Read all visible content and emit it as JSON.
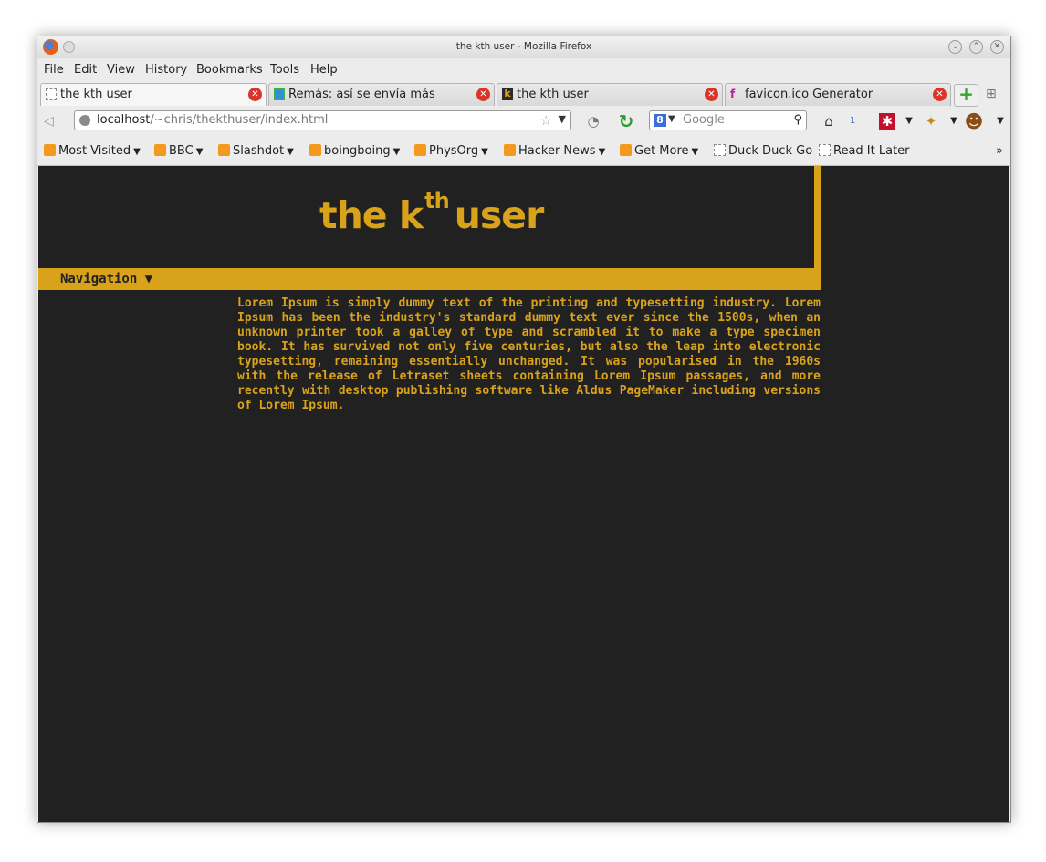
{
  "window": {
    "title": "the kth user - Mozilla Firefox"
  },
  "menu": {
    "items": [
      "File",
      "Edit",
      "View",
      "History",
      "Bookmarks",
      "Tools",
      "Help"
    ]
  },
  "tabs": [
    {
      "label": "the kth user",
      "active": true
    },
    {
      "label": "Remás: así se envía más",
      "active": false
    },
    {
      "label": "the kth user",
      "active": false
    },
    {
      "label": "favicon.ico Generator",
      "active": false
    }
  ],
  "navbar": {
    "url_host": "localhost",
    "url_path": "/~chris/thekthuser/index.html",
    "search_placeholder": "Google",
    "notification_count": "1"
  },
  "bookmarks": [
    {
      "label": "Most Visited",
      "icon": "folder-icon",
      "dropdown": true
    },
    {
      "label": "BBC",
      "icon": "rss-icon",
      "dropdown": true
    },
    {
      "label": "Slashdot",
      "icon": "rss-icon",
      "dropdown": true
    },
    {
      "label": "boingboing",
      "icon": "rss-icon",
      "dropdown": true
    },
    {
      "label": "PhysOrg",
      "icon": "rss-icon",
      "dropdown": true
    },
    {
      "label": "Hacker News",
      "icon": "rss-icon",
      "dropdown": true
    },
    {
      "label": "Get More",
      "icon": "rss-icon",
      "dropdown": true
    },
    {
      "label": "Duck Duck Go",
      "icon": "page-icon",
      "dropdown": false
    },
    {
      "label": "Read It Later",
      "icon": "page-icon",
      "dropdown": false
    }
  ],
  "page": {
    "title_pre": "the k",
    "title_sup": "th",
    "title_post": "user",
    "nav_label": "Navigation ▼",
    "body_text": "Lorem Ipsum is simply dummy text of the printing and typesetting industry. Lorem Ipsum has been the industry's standard dummy text ever since the 1500s, when an unknown printer took a galley of type and scrambled it to make a type specimen book. It has survived not only five centuries, but also the leap into electronic typesetting, remaining essentially unchanged. It was popularised in the 1960s with the release of Letraset sheets containing Lorem Ipsum passages, and more recently with desktop publishing software like Aldus PageMaker including versions of Lorem Ipsum."
  },
  "colors": {
    "accent": "#d9a21b",
    "page_background": "#212121"
  }
}
